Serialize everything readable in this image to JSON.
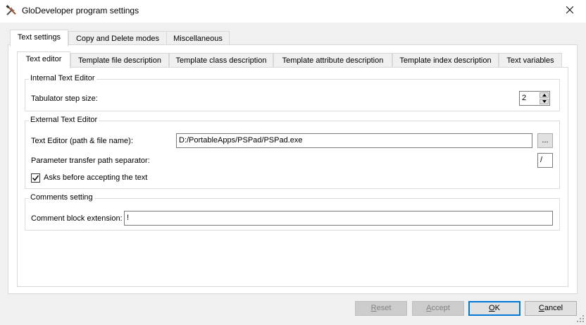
{
  "window": {
    "title": "GloDeveloper program settings",
    "icon": "tools-icon",
    "close_icon": "close-icon"
  },
  "main_tabs": [
    {
      "label": "Text settings",
      "active": true
    },
    {
      "label": "Copy and Delete modes",
      "active": false
    },
    {
      "label": "Miscellaneous",
      "active": false
    }
  ],
  "sub_tabs": [
    {
      "label": "Text editor",
      "active": true
    },
    {
      "label": "Template file description",
      "active": false
    },
    {
      "label": "Template class description",
      "active": false
    },
    {
      "label": "Template attribute description",
      "active": false
    },
    {
      "label": "Template index description",
      "active": false
    },
    {
      "label": "Text variables",
      "active": false
    }
  ],
  "internal_editor": {
    "title": "Internal Text Editor",
    "tab_step_label": "Tabulator step size:",
    "tab_step_value": "2"
  },
  "external_editor": {
    "title": "External Text Editor",
    "path_label": "Text Editor (path & file name):",
    "path_value": "D:/PortableApps/PSPad/PSPad.exe",
    "browse_label": "...",
    "separator_label": "Parameter transfer path separator:",
    "separator_value": "/",
    "ask_label": "Asks before accepting the text",
    "ask_checked": true
  },
  "comments": {
    "title": "Comments setting",
    "ext_label": "Comment block extension:",
    "ext_value": "!"
  },
  "buttons": {
    "reset": "Reset",
    "accept": "Accept",
    "ok": "OK",
    "cancel": "Cancel"
  },
  "colors": {
    "accent": "#0078d7",
    "disabled_text": "#838383"
  }
}
